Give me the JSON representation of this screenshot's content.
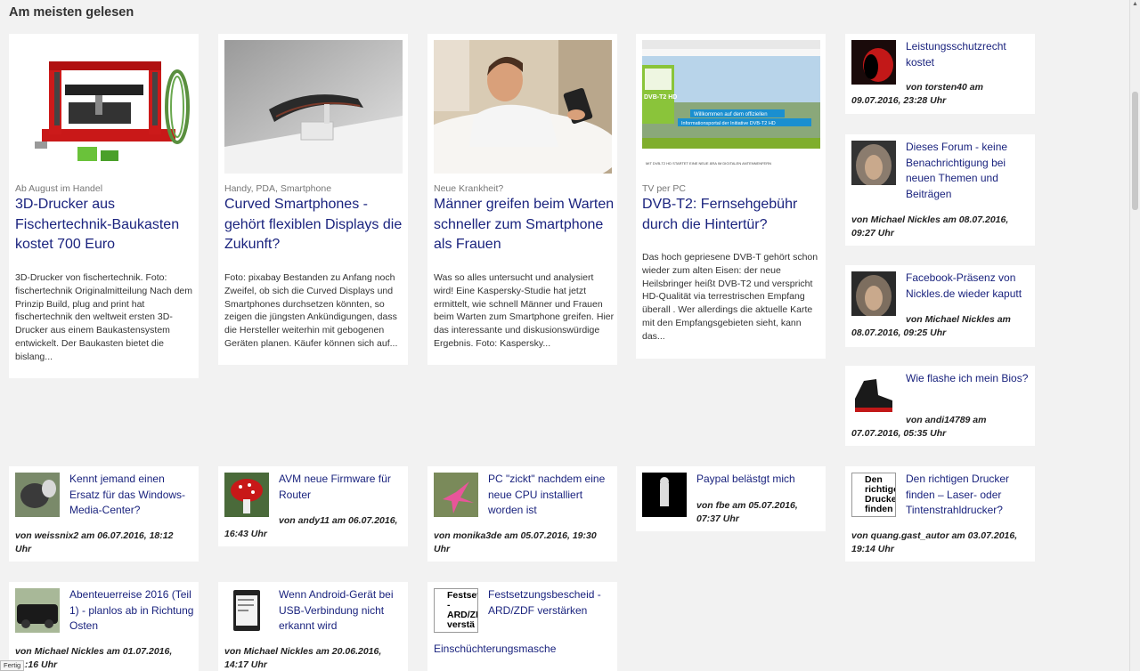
{
  "section_title": "Am meisten gelesen",
  "featured": [
    {
      "kicker": "Ab August im Handel",
      "title": "3D-Drucker aus Fischertechnik-Baukasten kostet 700 Euro",
      "text": "3D-Drucker von fischertechnik. Foto: fischertechnik Originalmitteilung Nach dem Prinzip Build, plug and print hat fischertechnik den weltweit ersten 3D-Drucker aus einem Baukastensystem entwickelt. Der Baukasten bietet die bislang..."
    },
    {
      "kicker": "Handy, PDA, Smartphone",
      "title": "Curved Smartphones - gehört flexiblen Displays die Zukunft?",
      "text": "Foto: pixabay Bestanden zu Anfang noch Zweifel, ob sich die Curved Displays und Smartphones durchsetzen könnten, so zeigen die jüngsten Ankündigungen, dass die Hersteller weiterhin mit gebogenen Geräten planen. Käufer können sich auf..."
    },
    {
      "kicker": "Neue Krankheit?",
      "title": "Männer greifen beim Warten schneller zum Smartphone als Frauen",
      "text": "Was so alles untersucht und analysiert wird! Eine Kaspersky-Studie hat jetzt ermittelt, wie schnell Männer und Frauen beim Warten zum Smartphone greifen. Hier das interessante und diskusionswürdige Ergebnis. Foto: Kaspersky..."
    },
    {
      "kicker": "TV per PC",
      "title": "DVB-T2: Fernsehgebühr durch die Hintertür?",
      "text": "Das hoch gepriesene DVB-T gehört schon wieder zum alten Eisen: der neue Heilsbringer heißt DVB-T2 und verspricht HD-Qualität via terrestrischen Empfang überall . Wer allerdings die aktuelle Karte mit den Empfangsgebieten sieht, kann das..."
    }
  ],
  "dvb_screenshot": {
    "logo": "DVB-T2 HD",
    "banner1": "Willkommen auf dem offiziellen",
    "banner2": "Informationsportal der Initiative DVB-T2 HD",
    "footer": "MIT DVB-T2 HD STARTET EINE NEUE ÄRA IM DIGITALEN ANTENNENFERN"
  },
  "forum": [
    {
      "title": "Leistungsschutzrecht kostet",
      "meta1": "von torsten40 am",
      "meta2": "09.07.2016, 23:28 Uhr"
    },
    {
      "title": "Dieses Forum - keine Benachrichtigung bei neuen Themen und Beiträgen",
      "meta1": "von Michael Nickles am 08.07.2016,",
      "meta2": "09:27 Uhr"
    },
    {
      "title": "Facebook-Präsenz von Nickles.de wieder kaputt",
      "meta1": "von Michael Nickles am",
      "meta2": "08.07.2016, 09:25 Uhr"
    },
    {
      "title": "Wie flashe ich mein Bios?",
      "meta1": "von andi14789 am",
      "meta2": "07.07.2016, 05:35 Uhr"
    },
    {
      "title": "Kennt jemand einen Ersatz für das Windows-Media-Center?",
      "meta1": "von weissnix2 am 06.07.2016, 18:12",
      "meta2": "Uhr"
    },
    {
      "title": "AVM neue Firmware für Router",
      "meta1": "von andy11 am 06.07.2016,",
      "meta2": "16:43 Uhr"
    },
    {
      "title": "PC \"zickt\" nachdem eine neue CPU installiert worden ist",
      "meta1": "von monika3de am 05.07.2016, 19:30",
      "meta2": "Uhr"
    },
    {
      "title": "Paypal belästgt mich",
      "meta1": "von fbe am 05.07.2016,",
      "meta2": "07:37 Uhr"
    },
    {
      "title": "Den richtigen Drucker finden – Laser- oder Tintenstrahldrucker?",
      "meta1": "von quang.gast_autor am 03.07.2016,",
      "meta2": "19:14 Uhr",
      "thumb_alt": "Den richtiger Drucker finden"
    },
    {
      "title": "Abenteuerreise 2016 (Teil 1) - planlos ab in Richtung Osten",
      "meta1": "von Michael Nickles am 01.07.2016,",
      "meta2": "11:16 Uhr"
    },
    {
      "title": "Wenn Android-Gerät bei USB-Verbindung nicht erkannt wird",
      "meta1": "von Michael Nickles am 20.06.2016,",
      "meta2": "14:17 Uhr"
    },
    {
      "title": "Festsetzungsbescheid - ARD/ZDF verstärken",
      "meta1": "Einschüchterungsmasche",
      "meta2": "",
      "thumb_alt": "Festsetzung - ARD/ZDF verstä"
    }
  ],
  "status_text": "Fertig"
}
